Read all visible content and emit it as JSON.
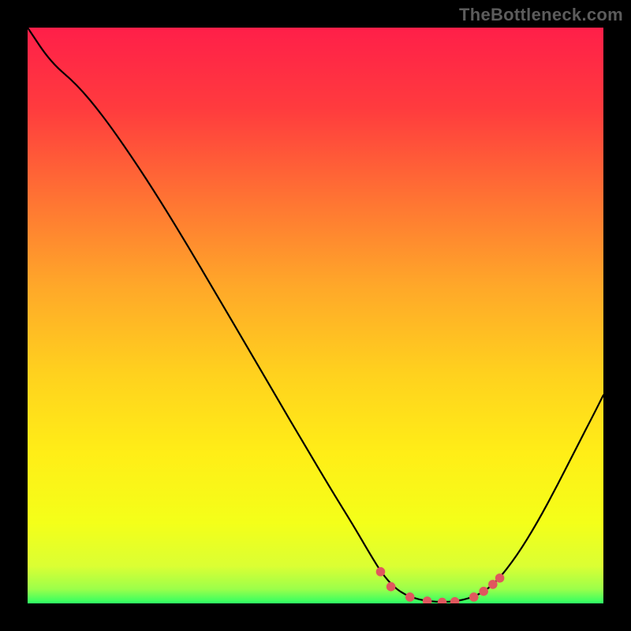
{
  "watermark": "TheBottleneck.com",
  "gradient": {
    "stops": [
      {
        "offset": 0.0,
        "color": "#ff1f49"
      },
      {
        "offset": 0.14,
        "color": "#ff3b3e"
      },
      {
        "offset": 0.3,
        "color": "#ff7433"
      },
      {
        "offset": 0.45,
        "color": "#ffa829"
      },
      {
        "offset": 0.6,
        "color": "#ffd11e"
      },
      {
        "offset": 0.74,
        "color": "#ffee17"
      },
      {
        "offset": 0.86,
        "color": "#f4ff19"
      },
      {
        "offset": 0.935,
        "color": "#dbff33"
      },
      {
        "offset": 0.975,
        "color": "#9cff4a"
      },
      {
        "offset": 1.0,
        "color": "#2dff64"
      }
    ]
  },
  "curve": {
    "stroke": "#000000",
    "strokeWidth": 2.2,
    "points": [
      {
        "x": 0.0,
        "y": 1.0
      },
      {
        "x": 0.04,
        "y": 0.94
      },
      {
        "x": 0.085,
        "y": 0.902
      },
      {
        "x": 0.13,
        "y": 0.848
      },
      {
        "x": 0.18,
        "y": 0.777
      },
      {
        "x": 0.23,
        "y": 0.7
      },
      {
        "x": 0.28,
        "y": 0.618
      },
      {
        "x": 0.33,
        "y": 0.533
      },
      {
        "x": 0.38,
        "y": 0.448
      },
      {
        "x": 0.43,
        "y": 0.362
      },
      {
        "x": 0.48,
        "y": 0.277
      },
      {
        "x": 0.53,
        "y": 0.193
      },
      {
        "x": 0.566,
        "y": 0.135
      },
      {
        "x": 0.595,
        "y": 0.085
      },
      {
        "x": 0.62,
        "y": 0.045
      },
      {
        "x": 0.648,
        "y": 0.018
      },
      {
        "x": 0.68,
        "y": 0.006
      },
      {
        "x": 0.715,
        "y": 0.002
      },
      {
        "x": 0.75,
        "y": 0.004
      },
      {
        "x": 0.785,
        "y": 0.015
      },
      {
        "x": 0.815,
        "y": 0.038
      },
      {
        "x": 0.85,
        "y": 0.083
      },
      {
        "x": 0.885,
        "y": 0.14
      },
      {
        "x": 0.92,
        "y": 0.205
      },
      {
        "x": 0.955,
        "y": 0.274
      },
      {
        "x": 0.985,
        "y": 0.332
      },
      {
        "x": 1.0,
        "y": 0.362
      }
    ]
  },
  "markers": {
    "color": "#e0575e",
    "radius": 5.8,
    "points": [
      {
        "x": 0.613,
        "y": 0.055
      },
      {
        "x": 0.631,
        "y": 0.029
      },
      {
        "x": 0.664,
        "y": 0.011
      },
      {
        "x": 0.694,
        "y": 0.004
      },
      {
        "x": 0.72,
        "y": 0.002
      },
      {
        "x": 0.742,
        "y": 0.003
      },
      {
        "x": 0.775,
        "y": 0.011
      },
      {
        "x": 0.792,
        "y": 0.021
      },
      {
        "x": 0.808,
        "y": 0.033
      },
      {
        "x": 0.82,
        "y": 0.044
      }
    ]
  },
  "chart_data": {
    "type": "line",
    "title": "",
    "xlabel": "",
    "ylabel": "",
    "xlim": [
      0,
      1
    ],
    "ylim": [
      0,
      1
    ],
    "grid": false,
    "legend": false,
    "annotations": [
      "TheBottleneck.com"
    ],
    "series": [
      {
        "name": "bottleneck-curve",
        "x": [
          0.0,
          0.04,
          0.085,
          0.13,
          0.18,
          0.23,
          0.28,
          0.33,
          0.38,
          0.43,
          0.48,
          0.53,
          0.566,
          0.595,
          0.62,
          0.648,
          0.68,
          0.715,
          0.75,
          0.785,
          0.815,
          0.85,
          0.885,
          0.92,
          0.955,
          0.985,
          1.0
        ],
        "y": [
          1.0,
          0.94,
          0.902,
          0.848,
          0.777,
          0.7,
          0.618,
          0.533,
          0.448,
          0.362,
          0.277,
          0.193,
          0.135,
          0.085,
          0.045,
          0.018,
          0.006,
          0.002,
          0.004,
          0.015,
          0.038,
          0.083,
          0.14,
          0.205,
          0.274,
          0.332,
          0.362
        ]
      },
      {
        "name": "optimal-region-markers",
        "type": "scatter",
        "x": [
          0.613,
          0.631,
          0.664,
          0.694,
          0.72,
          0.742,
          0.775,
          0.792,
          0.808,
          0.82
        ],
        "y": [
          0.055,
          0.029,
          0.011,
          0.004,
          0.002,
          0.003,
          0.011,
          0.021,
          0.033,
          0.044
        ]
      }
    ]
  }
}
